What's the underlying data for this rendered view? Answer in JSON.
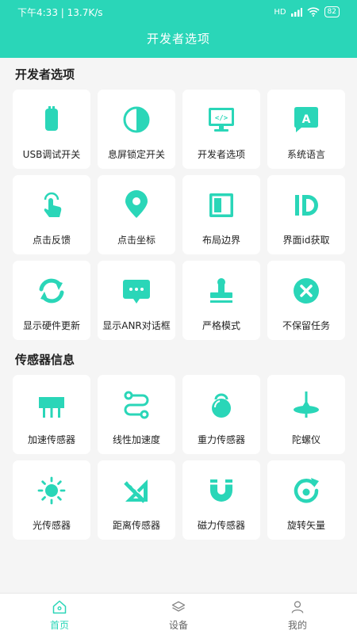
{
  "status": {
    "time": "下午4:33",
    "speed": "13.7K/s",
    "network": "HD",
    "battery": "82"
  },
  "header": {
    "title": "开发者选项"
  },
  "sections": [
    {
      "title": "开发者选项",
      "items": [
        {
          "label": "USB调试开关",
          "icon": "usb-icon"
        },
        {
          "label": "息屏锁定开关",
          "icon": "half-circle-icon"
        },
        {
          "label": "开发者选项",
          "icon": "code-monitor-icon"
        },
        {
          "label": "系统语言",
          "icon": "language-icon"
        },
        {
          "label": "点击反馈",
          "icon": "tap-hand-icon"
        },
        {
          "label": "点击坐标",
          "icon": "location-pin-icon"
        },
        {
          "label": "布局边界",
          "icon": "layout-bounds-icon"
        },
        {
          "label": "界面id获取",
          "icon": "id-icon"
        },
        {
          "label": "显示硬件更新",
          "icon": "refresh-icon"
        },
        {
          "label": "显示ANR对话框",
          "icon": "chat-bubble-icon"
        },
        {
          "label": "严格模式",
          "icon": "stamp-icon"
        },
        {
          "label": "不保留任务",
          "icon": "close-circle-icon"
        }
      ]
    },
    {
      "title": "传感器信息",
      "items": [
        {
          "label": "加速传感器",
          "icon": "chip-icon"
        },
        {
          "label": "线性加速度",
          "icon": "path-icon"
        },
        {
          "label": "重力传感器",
          "icon": "kettlebell-icon"
        },
        {
          "label": "陀螺仪",
          "icon": "gyroscope-icon"
        },
        {
          "label": "光传感器",
          "icon": "sun-icon"
        },
        {
          "label": "距离传感器",
          "icon": "ruler-icon"
        },
        {
          "label": "磁力传感器",
          "icon": "magnet-icon"
        },
        {
          "label": "旋转矢量",
          "icon": "rotate-icon"
        }
      ]
    }
  ],
  "tabs": [
    {
      "label": "首页",
      "icon": "home-icon",
      "active": true
    },
    {
      "label": "设备",
      "icon": "layers-icon",
      "active": false
    },
    {
      "label": "我的",
      "icon": "user-icon",
      "active": false
    }
  ],
  "colors": {
    "accent": "#2ad6b8",
    "background": "#f5f5f5",
    "card": "#ffffff"
  }
}
